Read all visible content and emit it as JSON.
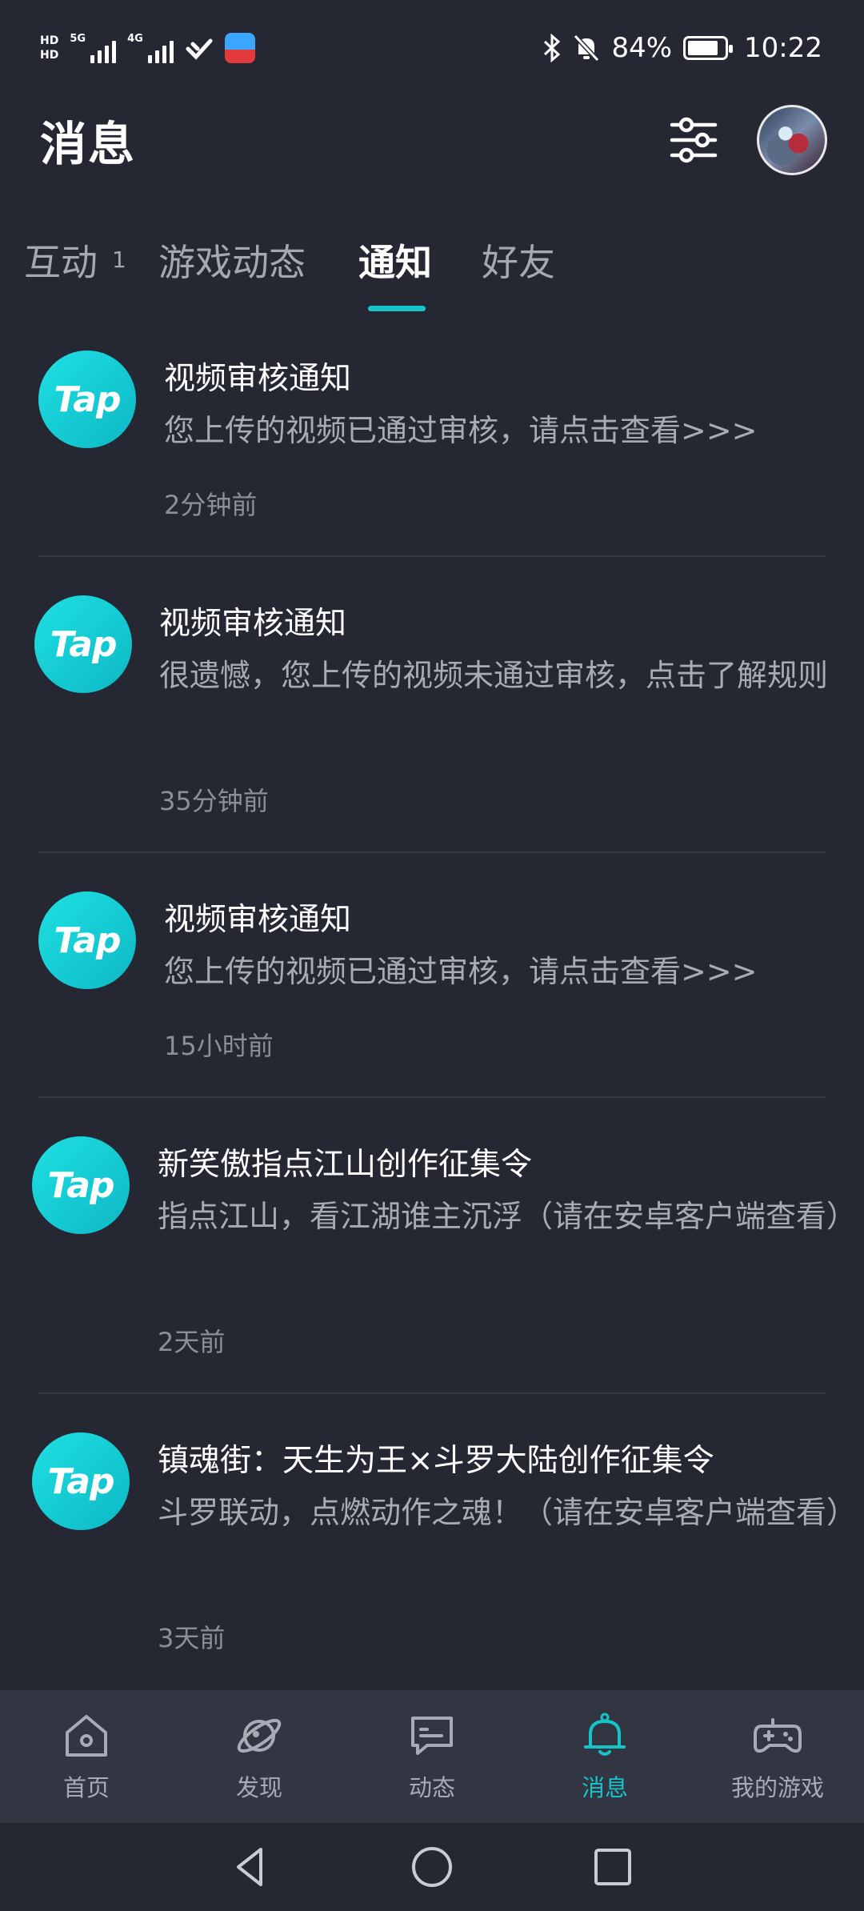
{
  "status_bar": {
    "hd1": "HD",
    "hd2": "HD",
    "net1": "5G",
    "net2": "4G",
    "battery_percent": "84%",
    "battery_level": 0.84,
    "time": "10:22",
    "icons": [
      "bluetooth-icon",
      "mute-bell-icon",
      "wifi-icon",
      "app-badge-icon"
    ]
  },
  "header": {
    "title": "消息"
  },
  "tabs": [
    {
      "label": "互动",
      "count": "1"
    },
    {
      "label": "游戏动态"
    },
    {
      "label": "通知",
      "active": true
    },
    {
      "label": "好友"
    }
  ],
  "logo_text": "Tap",
  "notifications": [
    {
      "title": "视频审核通知",
      "body": "您上传的视频已通过审核，请点击查看>>>",
      "time": "2分钟前"
    },
    {
      "title": "视频审核通知",
      "body": "很遗憾，您上传的视频未通过审核，点击了解规则",
      "time": "35分钟前"
    },
    {
      "title": "视频审核通知",
      "body": "您上传的视频已通过审核，请点击查看>>>",
      "time": "15小时前"
    },
    {
      "title": "新笑傲指点江山创作征集令",
      "body": "指点江山，看江湖谁主沉浮（请在安卓客户端查看）",
      "time": "2天前"
    },
    {
      "title": "镇魂街：天生为王×斗罗大陆创作征集令",
      "body": "斗罗联动，点燃动作之魂！（请在安卓客户端查看）",
      "time": "3天前"
    }
  ],
  "bottom_nav": [
    {
      "label": "首页",
      "icon": "home-icon"
    },
    {
      "label": "发现",
      "icon": "planet-icon"
    },
    {
      "label": "动态",
      "icon": "chat-icon"
    },
    {
      "label": "消息",
      "icon": "bell-icon",
      "active": true
    },
    {
      "label": "我的游戏",
      "icon": "gamepad-icon"
    }
  ],
  "colors": {
    "background": "#252733",
    "accent": "#16c3c8",
    "nav_background": "#323542"
  }
}
